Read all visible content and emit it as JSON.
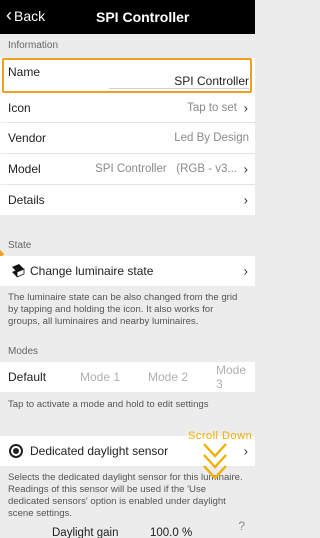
{
  "header": {
    "back_label": "Back",
    "title": "SPI Controller"
  },
  "sections": {
    "information": "Information",
    "state": "State",
    "modes": "Modes"
  },
  "info_rows": {
    "name": {
      "label": "Name",
      "value": "SPI Controller"
    },
    "icon": {
      "label": "Icon",
      "value": "Tap to set"
    },
    "vendor": {
      "label": "Vendor",
      "value": "Led By Design"
    },
    "model": {
      "label": "Model",
      "value": "SPI Controller   (RGB - v3..."
    },
    "details": {
      "label": "Details"
    }
  },
  "state_row": {
    "label": "Change luminaire state"
  },
  "state_desc": "The luminaire state can be also changed from the grid by tapping and holding the icon. It also works for groups, all luminaires and nearby luminaires.",
  "modes": [
    "Default",
    "Mode 1",
    "Mode 2",
    "Mode 3"
  ],
  "modes_hint": "Tap to activate a mode and hold to edit settings",
  "daylight": {
    "label": "Dedicated daylight sensor",
    "desc": "Selects the dedicated daylight sensor for this luminaire. Readings of this sensor will be used if the 'Use dedicated sensors' option is enabled under daylight scene settings."
  },
  "overlay": {
    "scroll_hint": "Scroll Down"
  },
  "daylight_gain": {
    "label": "Daylight gain",
    "value": "100.0 %"
  },
  "help_mark": "?",
  "colors": {
    "accent": "#f0a020",
    "scroll_hint": "#f0b000"
  }
}
